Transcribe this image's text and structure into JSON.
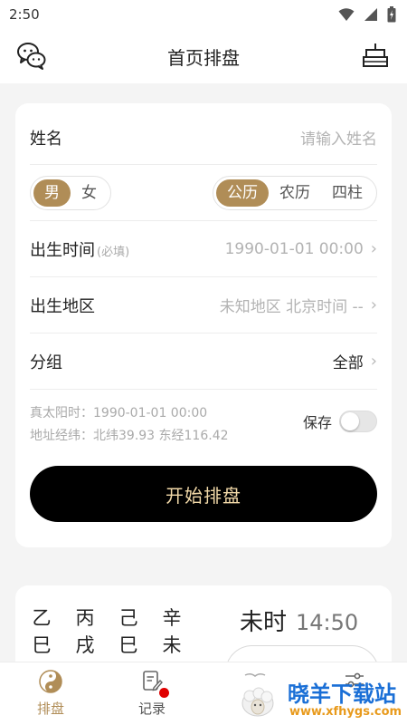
{
  "status": {
    "time": "2:50"
  },
  "header": {
    "title": "首页排盘",
    "left_icon": "wechat-icon",
    "right_icon": "birthday-cake-icon"
  },
  "form": {
    "name_label": "姓名",
    "name_placeholder": "请输入姓名",
    "gender": {
      "options": [
        "男",
        "女"
      ],
      "selected": "男"
    },
    "calendar": {
      "options": [
        "公历",
        "农历",
        "四柱"
      ],
      "selected": "公历"
    },
    "birth_time_label": "出生时间",
    "birth_time_required": "(必填)",
    "birth_time_value": "1990-01-01 00:00",
    "birth_place_label": "出生地区",
    "birth_place_value": "未知地区 北京时间 --",
    "group_label": "分组",
    "group_value": "全部",
    "solar_time": "真太阳时：1990-01-01 00:00",
    "coordinates": "地址经纬：北纬39.93 东经116.42",
    "save_label": "保存",
    "save_enabled": false,
    "start_button": "开始排盘"
  },
  "bazi": {
    "stems": [
      "乙",
      "丙",
      "己",
      "辛"
    ],
    "branches": [
      "巳",
      "戌",
      "巳",
      "未"
    ],
    "hour_name": "未时",
    "hour_time": "14:50"
  },
  "nav": {
    "items": [
      {
        "label": "排盘",
        "icon": "yin-yang-icon",
        "active": true
      },
      {
        "label": "记录",
        "icon": "edit-note-icon",
        "active": false,
        "badge": true
      },
      {
        "label": "",
        "icon": "book-icon",
        "active": false
      },
      {
        "label": "",
        "icon": "settings-sliders-icon",
        "active": false
      }
    ]
  },
  "watermark": {
    "cn": "晓羊下载站",
    "en": "www.xfhygs.com"
  },
  "colors": {
    "accent": "#b08d57",
    "button_bg": "#000000",
    "button_text": "#f2d9a8",
    "badge": "#e00000"
  }
}
